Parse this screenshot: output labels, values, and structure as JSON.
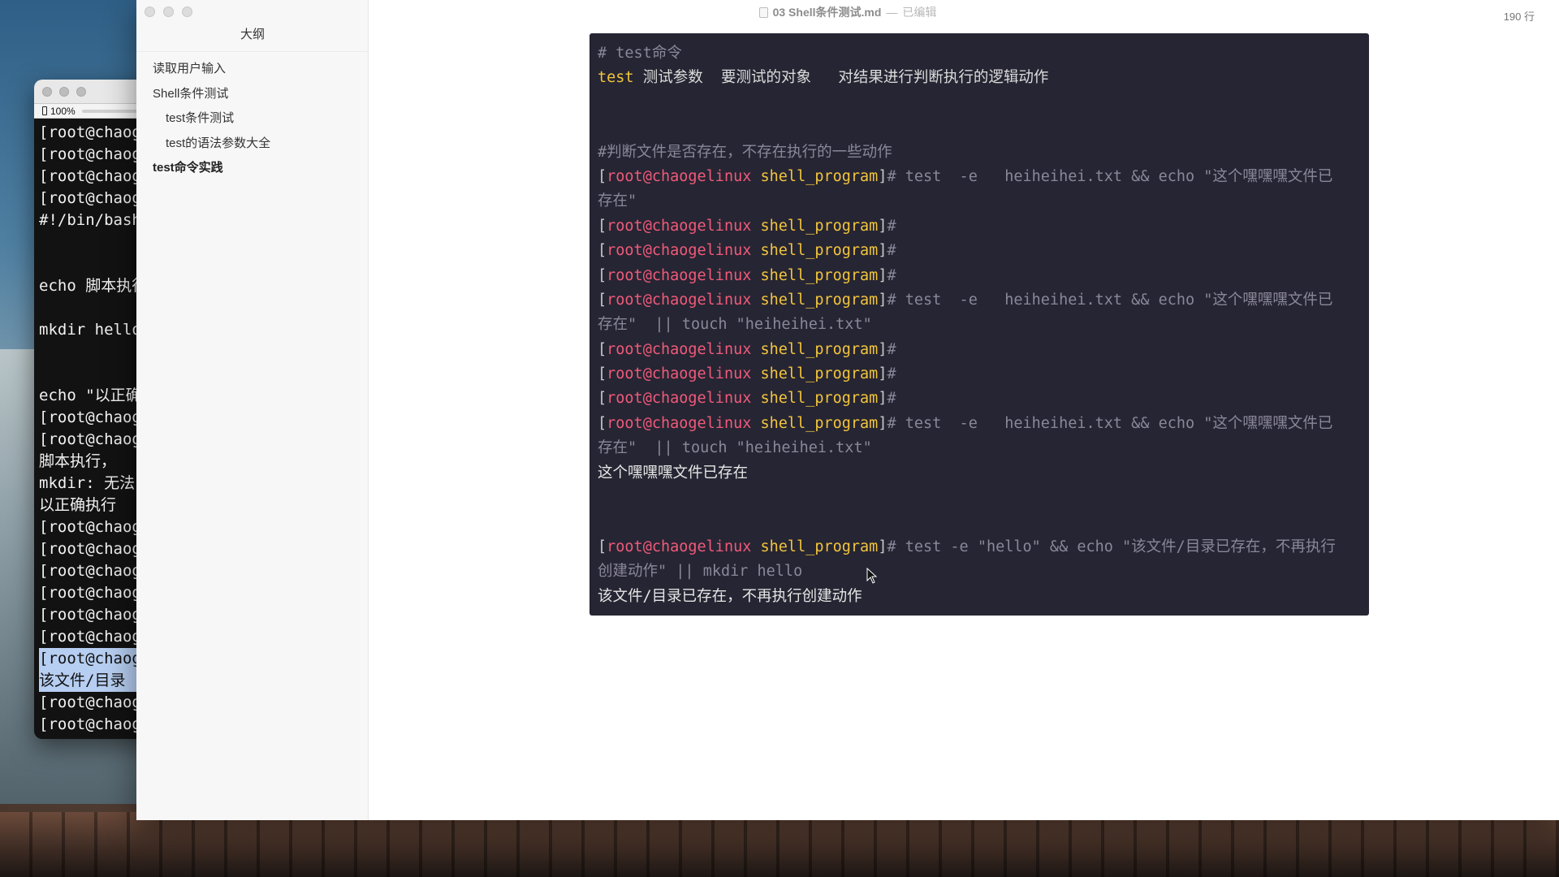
{
  "terminal": {
    "zoom": "100%",
    "lines": [
      {
        "text": "[root@chaogelinux",
        "highlight": false
      },
      {
        "text": "[root@chaogelinux",
        "highlight": false
      },
      {
        "text": "[root@chaogelinux",
        "highlight": false
      },
      {
        "text": "[root@chaogelinux",
        "highlight": false
      },
      {
        "text": "#!/bin/bash",
        "highlight": false
      },
      {
        "text": "",
        "highlight": false
      },
      {
        "text": "",
        "highlight": false
      },
      {
        "text": "echo 脚本执行",
        "highlight": false
      },
      {
        "text": "",
        "highlight": false
      },
      {
        "text": "mkdir hello",
        "highlight": false
      },
      {
        "text": "",
        "highlight": false
      },
      {
        "text": "",
        "highlight": false
      },
      {
        "text": "echo \"以正确",
        "highlight": false
      },
      {
        "text": "[root@chaogelinux",
        "highlight": false
      },
      {
        "text": "[root@chaogelinux",
        "highlight": false
      },
      {
        "text": "脚本执行，",
        "highlight": false
      },
      {
        "text": "mkdir: 无法",
        "highlight": false
      },
      {
        "text": "以正确执行",
        "highlight": false
      },
      {
        "text": "[root@chaogelinux",
        "highlight": false
      },
      {
        "text": "[root@chaogelinux",
        "highlight": false
      },
      {
        "text": "[root@chaogelinux",
        "highlight": false
      },
      {
        "text": "[root@chaogelinux",
        "highlight": false
      },
      {
        "text": "[root@chaogelinux",
        "highlight": false
      },
      {
        "text": "[root@chaogelinux",
        "highlight": false
      },
      {
        "text": "[root@chaogelinux",
        "highlight": true
      },
      {
        "text": "该文件/目录",
        "highlight": true
      },
      {
        "text": "[root@chaogelinux",
        "highlight": false
      },
      {
        "text": "[root@chaogelinux",
        "highlight": false
      }
    ]
  },
  "window": {
    "file_name": "03 Shell条件测试.md",
    "separator": "—",
    "status": "已编辑",
    "line_count": "190 行"
  },
  "sidebar": {
    "title": "大纲",
    "items": [
      {
        "label": "读取用户输入",
        "level": 1,
        "active": false
      },
      {
        "label": "Shell条件测试",
        "level": 1,
        "active": false
      },
      {
        "label": "test条件测试",
        "level": 2,
        "active": false
      },
      {
        "label": "test的语法参数大全",
        "level": 2,
        "active": false
      },
      {
        "label": "test命令实践",
        "level": 1,
        "active": true
      }
    ]
  },
  "code": {
    "lines": [
      [
        {
          "t": "# test命令",
          "c": "comment"
        }
      ],
      [
        {
          "t": "test",
          "c": "keyword"
        },
        {
          "t": " 测试参数  要测试的对象   对结果进行判断执行的逻辑动作",
          "c": "plain"
        }
      ],
      [],
      [],
      [
        {
          "t": "#判断文件是否存在，不存在执行的一些动作",
          "c": "comment"
        }
      ],
      [
        {
          "t": "[",
          "c": "bracket"
        },
        {
          "t": "root",
          "c": "user"
        },
        {
          "t": "@",
          "c": "at"
        },
        {
          "t": "chaogelinux",
          "c": "user"
        },
        {
          "t": " ",
          "c": "plain"
        },
        {
          "t": "shell_program",
          "c": "dir"
        },
        {
          "t": "]",
          "c": "bracket"
        },
        {
          "t": "# test  -e   heiheihei.txt && echo \"这个嘿嘿嘿文件已",
          "c": "cmd"
        }
      ],
      [
        {
          "t": "存在\"",
          "c": "cmd"
        }
      ],
      [
        {
          "t": "[",
          "c": "bracket"
        },
        {
          "t": "root",
          "c": "user"
        },
        {
          "t": "@",
          "c": "at"
        },
        {
          "t": "chaogelinux",
          "c": "user"
        },
        {
          "t": " ",
          "c": "plain"
        },
        {
          "t": "shell_program",
          "c": "dir"
        },
        {
          "t": "]",
          "c": "bracket"
        },
        {
          "t": "#",
          "c": "cmd"
        }
      ],
      [
        {
          "t": "[",
          "c": "bracket"
        },
        {
          "t": "root",
          "c": "user"
        },
        {
          "t": "@",
          "c": "at"
        },
        {
          "t": "chaogelinux",
          "c": "user"
        },
        {
          "t": " ",
          "c": "plain"
        },
        {
          "t": "shell_program",
          "c": "dir"
        },
        {
          "t": "]",
          "c": "bracket"
        },
        {
          "t": "#",
          "c": "cmd"
        }
      ],
      [
        {
          "t": "[",
          "c": "bracket"
        },
        {
          "t": "root",
          "c": "user"
        },
        {
          "t": "@",
          "c": "at"
        },
        {
          "t": "chaogelinux",
          "c": "user"
        },
        {
          "t": " ",
          "c": "plain"
        },
        {
          "t": "shell_program",
          "c": "dir"
        },
        {
          "t": "]",
          "c": "bracket"
        },
        {
          "t": "#",
          "c": "cmd"
        }
      ],
      [
        {
          "t": "[",
          "c": "bracket"
        },
        {
          "t": "root",
          "c": "user"
        },
        {
          "t": "@",
          "c": "at"
        },
        {
          "t": "chaogelinux",
          "c": "user"
        },
        {
          "t": " ",
          "c": "plain"
        },
        {
          "t": "shell_program",
          "c": "dir"
        },
        {
          "t": "]",
          "c": "bracket"
        },
        {
          "t": "# test  -e   heiheihei.txt && echo \"这个嘿嘿嘿文件已",
          "c": "cmd"
        }
      ],
      [
        {
          "t": "存在\"  || touch \"heiheihei.txt\"",
          "c": "cmd"
        }
      ],
      [
        {
          "t": "[",
          "c": "bracket"
        },
        {
          "t": "root",
          "c": "user"
        },
        {
          "t": "@",
          "c": "at"
        },
        {
          "t": "chaogelinux",
          "c": "user"
        },
        {
          "t": " ",
          "c": "plain"
        },
        {
          "t": "shell_program",
          "c": "dir"
        },
        {
          "t": "]",
          "c": "bracket"
        },
        {
          "t": "#",
          "c": "cmd"
        }
      ],
      [
        {
          "t": "[",
          "c": "bracket"
        },
        {
          "t": "root",
          "c": "user"
        },
        {
          "t": "@",
          "c": "at"
        },
        {
          "t": "chaogelinux",
          "c": "user"
        },
        {
          "t": " ",
          "c": "plain"
        },
        {
          "t": "shell_program",
          "c": "dir"
        },
        {
          "t": "]",
          "c": "bracket"
        },
        {
          "t": "#",
          "c": "cmd"
        }
      ],
      [
        {
          "t": "[",
          "c": "bracket"
        },
        {
          "t": "root",
          "c": "user"
        },
        {
          "t": "@",
          "c": "at"
        },
        {
          "t": "chaogelinux",
          "c": "user"
        },
        {
          "t": " ",
          "c": "plain"
        },
        {
          "t": "shell_program",
          "c": "dir"
        },
        {
          "t": "]",
          "c": "bracket"
        },
        {
          "t": "#",
          "c": "cmd"
        }
      ],
      [
        {
          "t": "[",
          "c": "bracket"
        },
        {
          "t": "root",
          "c": "user"
        },
        {
          "t": "@",
          "c": "at"
        },
        {
          "t": "chaogelinux",
          "c": "user"
        },
        {
          "t": " ",
          "c": "plain"
        },
        {
          "t": "shell_program",
          "c": "dir"
        },
        {
          "t": "]",
          "c": "bracket"
        },
        {
          "t": "# test  -e   heiheihei.txt && echo \"这个嘿嘿嘿文件已",
          "c": "cmd"
        }
      ],
      [
        {
          "t": "存在\"  || touch \"heiheihei.txt\"",
          "c": "cmd"
        }
      ],
      [
        {
          "t": "这个嘿嘿嘿文件已存在",
          "c": "out"
        }
      ],
      [],
      [],
      [
        {
          "t": "[",
          "c": "bracket"
        },
        {
          "t": "root",
          "c": "user"
        },
        {
          "t": "@",
          "c": "at"
        },
        {
          "t": "chaogelinux",
          "c": "user"
        },
        {
          "t": " ",
          "c": "plain"
        },
        {
          "t": "shell_program",
          "c": "dir"
        },
        {
          "t": "]",
          "c": "bracket"
        },
        {
          "t": "# test -e \"hello\" && echo \"该文件/目录已存在，不再执行",
          "c": "cmd"
        }
      ],
      [
        {
          "t": "创建动作\" || mkdir hello",
          "c": "cmd"
        }
      ],
      [
        {
          "t": "该文件/目录已存在，不再执行创建动作",
          "c": "out"
        }
      ]
    ]
  },
  "colors": {
    "code_bg": "#262533",
    "prompt_user": "#f05a7a",
    "prompt_dir": "#f2c53d",
    "comment": "#8a8799"
  }
}
